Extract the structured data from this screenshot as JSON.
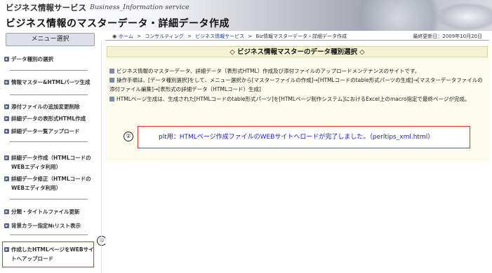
{
  "header": {
    "site_name": "ビジネス情報サービス",
    "site_name_en": "Business_Information service",
    "page_title": "ビジネス情報のマスターデータ・詳細データ作成"
  },
  "sidebar": {
    "menu_title": "メニュー選択",
    "items": [
      {
        "label": "データ種別の選択"
      },
      {
        "label": "情報マスター&HTMLパーツ生成"
      },
      {
        "label": "添付ファイルの追加変更削除"
      },
      {
        "label": "詳細データの表形式HTML作成"
      },
      {
        "label": "詳細データ一覧アップロード"
      },
      {
        "label": "詳細データ作成（HTMLコードのWEBエディタ利用）"
      },
      {
        "label": "詳細データ修正（HTMLコードのWEBエディタ利用）"
      },
      {
        "label": "分類・タイトルファイル更新"
      },
      {
        "label": "背景カラー指定№リスト表示"
      },
      {
        "label": "作成したHTMLページをWEBサイトへアップロード"
      }
    ],
    "marker": "①"
  },
  "breadcrumb": {
    "home_icon": "circle-icon",
    "items": [
      "ホーム",
      "コンサルティング",
      "ビジネス情報サービス",
      "Biz情報マスターデータ・詳細データ作成"
    ],
    "separator": ">",
    "updated": "最終更新日：2009年10月20日"
  },
  "panel": {
    "heading": "◇ ビジネス情報マスターのデータ種別選択 ◇",
    "lines": [
      "ビジネス情報のマスターデータ、詳細データ（表形式HTML）作成及び添付ファイルのアップロードメンテナンスのサイトです。",
      "操作手順は、[データ種別選択]をして、メニュー選択から[マスターファイルの作成]→[HTMLコードのtable形式パーツの生成]→[マスターデータファイルの添付ファイル編集]→[表形式の詳細データ（HTMLコード）生成]",
      "HTMLページ生成は、生成された[HTMLコードのtable形式パーツ]を[HTMLページ制作システム]におけるExcel上のmacro指定で最終ページが完成。"
    ]
  },
  "notice": {
    "marker": "②",
    "text": "plt用：HTMLページ作成ファイルのWEBサイトへロードが完了しました。（perltips_xml.html）"
  },
  "colors": {
    "highlight": "#e03030",
    "notice_text": "#1a1ad0",
    "panel_bg": "#fcfcec"
  }
}
